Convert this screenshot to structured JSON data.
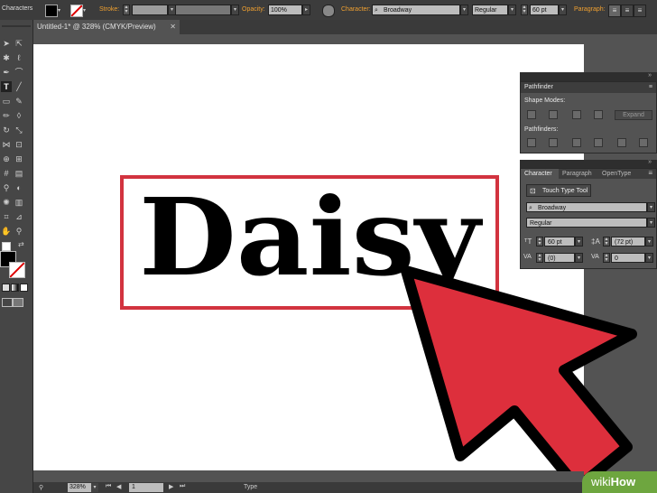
{
  "control_bar": {
    "panel_label": "Characters",
    "stroke_label": "Stroke:",
    "opacity_label": "Opacity:",
    "opacity_value": "100%",
    "character_label": "Character:",
    "font_family": "Broadway",
    "font_style": "Regular",
    "font_size": "60 pt",
    "paragraph_label": "Paragraph:"
  },
  "document": {
    "tab_title": "Untitled-1* @ 328% (CMYK/Preview)"
  },
  "artwork": {
    "text": "Daisy",
    "frame_color": "#d2333f",
    "arrow_color": "#dd2f3c"
  },
  "pathfinder_panel": {
    "title": "Pathfinder",
    "shape_modes_label": "Shape Modes:",
    "expand_label": "Expand",
    "pathfinders_label": "Pathfinders:"
  },
  "character_panel": {
    "tabs": [
      "Character",
      "Paragraph",
      "OpenType"
    ],
    "touch_type_tool": "Touch Type Tool",
    "font_family": "Broadway",
    "font_style": "Regular",
    "font_size": "60 pt",
    "leading": "(72 pt)",
    "kerning": "(0)",
    "tracking": "0"
  },
  "status_bar": {
    "zoom": "328%",
    "page": "1",
    "mode": "Type"
  },
  "watermark": {
    "prefix": "wiki",
    "suffix": "How"
  }
}
